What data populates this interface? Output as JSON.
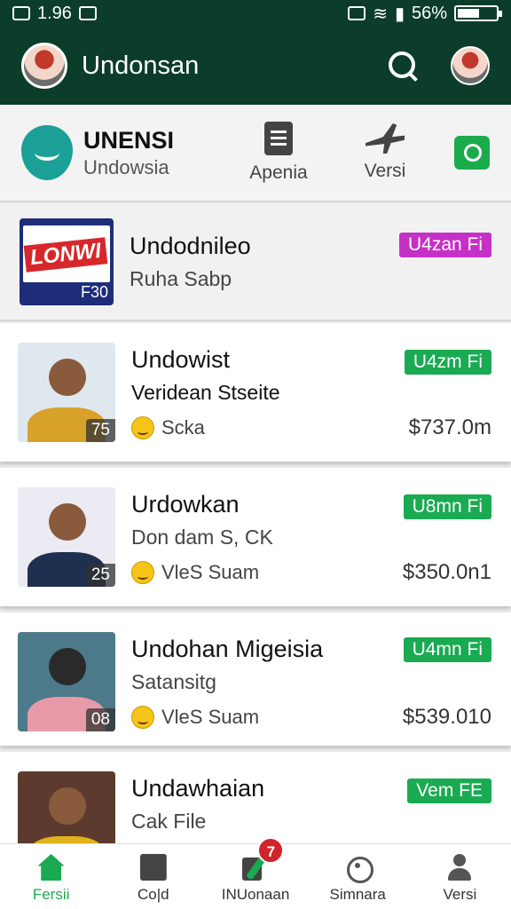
{
  "status_bar": {
    "time": "1.96",
    "battery": "56%",
    "battery_level": 0.56
  },
  "app_bar": {
    "title": "Undonsan"
  },
  "channel": {
    "name": "UNENSI",
    "subtitle": "Undowsia",
    "nav": [
      {
        "label": "Apenia",
        "icon": "document-icon"
      },
      {
        "label": "Versi",
        "icon": "plane-icon"
      }
    ]
  },
  "featured": {
    "title": "Undodnileo",
    "subtitle": "Ruha Sabp",
    "tag": "U4zan Fi",
    "thumb_word": "LONWI",
    "thumb_code": "F30",
    "tag_color": "#c530c7"
  },
  "items": [
    {
      "title": "Undowist",
      "subtitle": "Veridean Stseite",
      "meta": "Scka",
      "price": "$737.0m",
      "tag": "U4zm Fi",
      "count": "75"
    },
    {
      "title": "Urdowkan",
      "subtitle": "Don dam S, CK",
      "meta": "VleS Suam",
      "price": "$350.0n1",
      "tag": "U8mn Fi",
      "count": "25"
    },
    {
      "title": "Undohan Migeisia",
      "subtitle": "Satansitg",
      "meta": "VleS Suam",
      "price": "$539.010",
      "tag": "U4mn Fi",
      "count": "08"
    },
    {
      "title": "Undawhaian",
      "subtitle": "Cak File",
      "tag": "Vem FE"
    }
  ],
  "bottom_nav": [
    {
      "label": "Fersii",
      "icon": "home-icon"
    },
    {
      "label": "Co|d",
      "icon": "chart-icon"
    },
    {
      "label": "INUonaan",
      "icon": "edit-icon",
      "badge": "7"
    },
    {
      "label": "Simnara",
      "icon": "stats-icon"
    },
    {
      "label": "Versi",
      "icon": "person-icon"
    }
  ],
  "colors": {
    "primary": "#0b3d2a",
    "accent": "#1aaa52",
    "purple_tag": "#c530c7"
  }
}
